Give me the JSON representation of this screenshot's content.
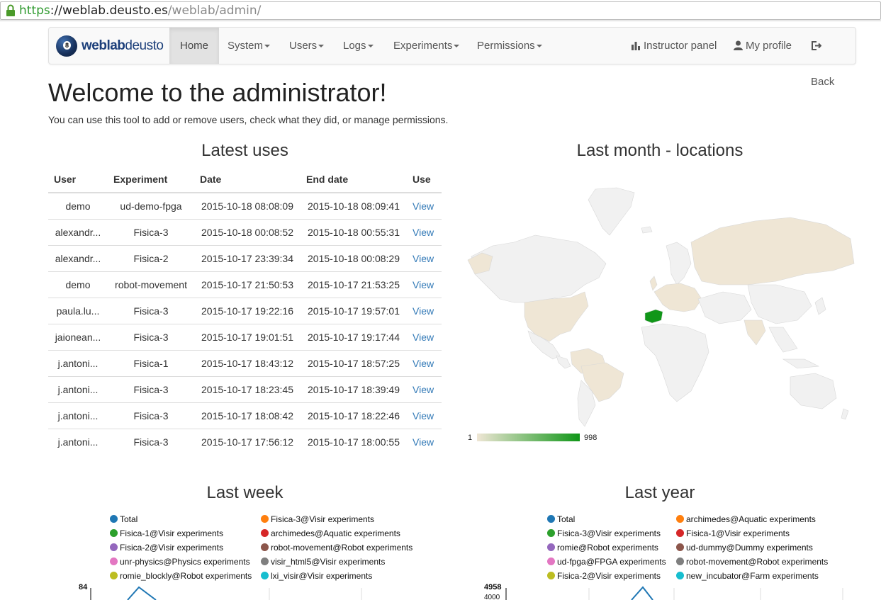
{
  "browser": {
    "url_scheme": "https",
    "url_sep": "://",
    "url_host": "weblab.deusto.es",
    "url_path": "/weblab/admin/"
  },
  "navbar": {
    "brand_bold": "weblab",
    "brand_light": "deusto",
    "items": [
      {
        "label": "Home",
        "active": true
      },
      {
        "label": "System",
        "dropdown": true
      },
      {
        "label": "Users",
        "dropdown": true
      },
      {
        "label": "Logs",
        "dropdown": true
      },
      {
        "label": "Experiments",
        "dropdown": true
      },
      {
        "label": "Permissions",
        "dropdown": true
      }
    ],
    "right": [
      {
        "label": "Instructor panel",
        "icon": "bar-chart-icon"
      },
      {
        "label": "My profile",
        "icon": "user-icon"
      },
      {
        "label": "Back",
        "icon": "back-icon"
      }
    ]
  },
  "page": {
    "title": "Welcome to the administrator!",
    "lead": "You can use this tool to add or remove users, check what they did, or manage permissions."
  },
  "latest_uses": {
    "title": "Latest uses",
    "columns": [
      "User",
      "Experiment",
      "Date",
      "End date",
      "Use"
    ],
    "rows": [
      {
        "user": "demo",
        "experiment": "ud-demo-fpga",
        "date": "2015-10-18 08:08:09",
        "end": "2015-10-18 08:09:41",
        "use": "View"
      },
      {
        "user": "alexandr...",
        "experiment": "Fisica-3",
        "date": "2015-10-18 00:08:52",
        "end": "2015-10-18 00:55:31",
        "use": "View"
      },
      {
        "user": "alexandr...",
        "experiment": "Fisica-2",
        "date": "2015-10-17 23:39:34",
        "end": "2015-10-18 00:08:29",
        "use": "View"
      },
      {
        "user": "demo",
        "experiment": "robot-movement",
        "date": "2015-10-17 21:50:53",
        "end": "2015-10-17 21:53:25",
        "use": "View"
      },
      {
        "user": "paula.lu...",
        "experiment": "Fisica-3",
        "date": "2015-10-17 19:22:16",
        "end": "2015-10-17 19:57:01",
        "use": "View"
      },
      {
        "user": "jaionean...",
        "experiment": "Fisica-3",
        "date": "2015-10-17 19:01:51",
        "end": "2015-10-17 19:17:44",
        "use": "View"
      },
      {
        "user": "j.antoni...",
        "experiment": "Fisica-1",
        "date": "2015-10-17 18:43:12",
        "end": "2015-10-17 18:57:25",
        "use": "View"
      },
      {
        "user": "j.antoni...",
        "experiment": "Fisica-3",
        "date": "2015-10-17 18:23:45",
        "end": "2015-10-17 18:39:49",
        "use": "View"
      },
      {
        "user": "j.antoni...",
        "experiment": "Fisica-3",
        "date": "2015-10-17 18:08:42",
        "end": "2015-10-17 18:22:46",
        "use": "View"
      },
      {
        "user": "j.antoni...",
        "experiment": "Fisica-3",
        "date": "2015-10-17 17:56:12",
        "end": "2015-10-17 18:00:55",
        "use": "View"
      }
    ]
  },
  "locations": {
    "title": "Last month - locations",
    "legend_min": "1",
    "legend_max": "998",
    "color_low": "#efe6d5",
    "color_high": "#109618",
    "color_none": "#f1f1f1"
  },
  "last_week": {
    "title": "Last week",
    "legend": [
      {
        "name": "Total",
        "color": "#1f77b4"
      },
      {
        "name": "Fisica-3@Visir experiments",
        "color": "#ff7f0e"
      },
      {
        "name": "Fisica-1@Visir experiments",
        "color": "#2ca02c"
      },
      {
        "name": "archimedes@Aquatic experiments",
        "color": "#d62728"
      },
      {
        "name": "Fisica-2@Visir experiments",
        "color": "#9467bd"
      },
      {
        "name": "robot-movement@Robot experiments",
        "color": "#8c564b"
      },
      {
        "name": "unr-physics@Physics experiments",
        "color": "#e377c2"
      },
      {
        "name": "visir_html5@Visir experiments",
        "color": "#7f7f7f"
      },
      {
        "name": "romie_blockly@Robot experiments",
        "color": "#bcbd22"
      },
      {
        "name": "lxi_visir@Visir experiments",
        "color": "#17becf"
      }
    ],
    "y_max_label": "84"
  },
  "last_year": {
    "title": "Last year",
    "legend": [
      {
        "name": "Total",
        "color": "#1f77b4"
      },
      {
        "name": "archimedes@Aquatic experiments",
        "color": "#ff7f0e"
      },
      {
        "name": "Fisica-3@Visir experiments",
        "color": "#2ca02c"
      },
      {
        "name": "Fisica-1@Visir experiments",
        "color": "#d62728"
      },
      {
        "name": "romie@Robot experiments",
        "color": "#9467bd"
      },
      {
        "name": "ud-dummy@Dummy experiments",
        "color": "#8c564b"
      },
      {
        "name": "ud-fpga@FPGA experiments",
        "color": "#e377c2"
      },
      {
        "name": "robot-movement@Robot experiments",
        "color": "#7f7f7f"
      },
      {
        "name": "Fisica-2@Visir experiments",
        "color": "#bcbd22"
      },
      {
        "name": "new_incubator@Farm experiments",
        "color": "#17becf"
      }
    ],
    "y_max_label": "4958",
    "y_tick_label": "4000"
  }
}
